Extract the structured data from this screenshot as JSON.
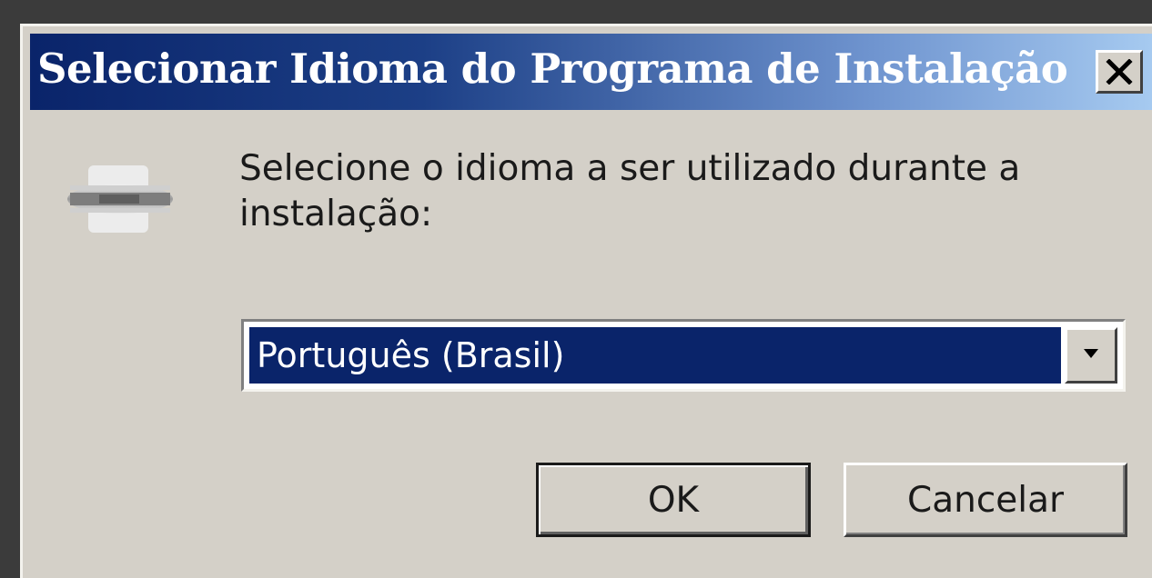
{
  "dialog": {
    "title": "Selecionar Idioma do Programa de Instalação",
    "prompt": "Selecione o idioma a ser utilizado durante a instalação:",
    "language_select": {
      "selected": "Português (Brasil)"
    },
    "buttons": {
      "ok_label": "OK",
      "cancel_label": "Cancelar"
    },
    "icons": {
      "close": "close-icon",
      "app": "setup-icon",
      "dropdown": "chevron-down-icon"
    }
  },
  "colors": {
    "titlebar_start": "#0a246a",
    "titlebar_end": "#a6caf0",
    "dialog_face": "#d4d0c8",
    "selection": "#0a246a"
  }
}
